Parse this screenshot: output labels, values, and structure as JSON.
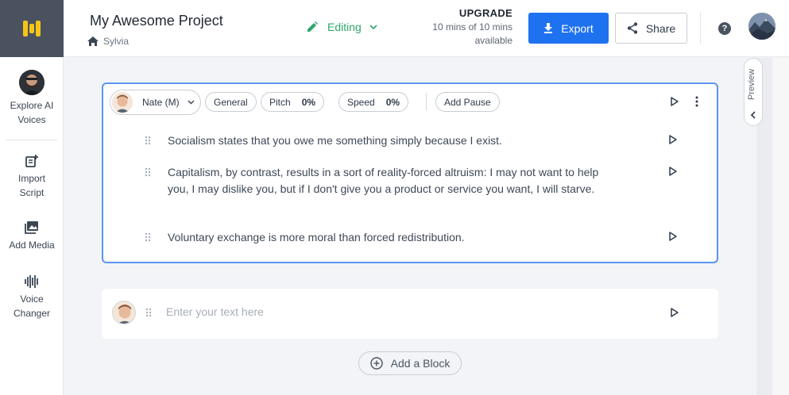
{
  "app": {
    "logo": "logo-icon"
  },
  "sidebar": {
    "items": [
      {
        "label": "Explore AI Voices",
        "icon": "voice-avatar"
      },
      {
        "label": "Import Script",
        "icon": "import-script-icon"
      },
      {
        "label": "Add Media",
        "icon": "add-media-icon"
      },
      {
        "label": "Voice Changer",
        "icon": "voice-changer-icon"
      }
    ]
  },
  "header": {
    "project_title": "My Awesome Project",
    "breadcrumb_user": "Sylvia",
    "editing_label": "Editing",
    "upgrade_label": "UPGRADE",
    "usage_text": "10 mins of 10 mins available",
    "export_label": "Export",
    "share_label": "Share",
    "help_label": "?"
  },
  "block": {
    "voice_name": "Nate (M)",
    "style_label": "General",
    "pitch_label": "Pitch",
    "pitch_value": "0%",
    "speed_label": "Speed",
    "speed_value": "0%",
    "add_pause_label": "Add Pause",
    "paragraphs": [
      "Socialism states that you owe me something simply because I exist.",
      "Capitalism, by contrast, results in a sort of reality-forced altruism: I may not want to help you, I may dislike you, but if I don't give you a product or service you want, I will starve.",
      "Voluntary exchange is more moral than forced redistribution."
    ]
  },
  "new_block": {
    "placeholder": "Enter your text here"
  },
  "add_block_label": "Add a Block",
  "preview_label": "Preview",
  "colors": {
    "accent": "#1e72f0",
    "editing": "#2fa86a",
    "selected_border": "#5b95f0"
  }
}
